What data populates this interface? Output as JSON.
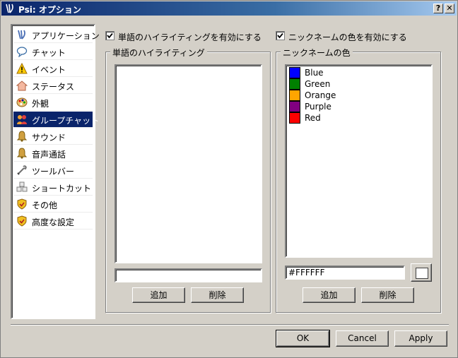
{
  "window": {
    "title": "Psi: オプション",
    "help_label": "?",
    "close_label": "✕"
  },
  "sidebar": {
    "items": [
      {
        "label": "アプリケーション",
        "icon": "psi-logo-icon"
      },
      {
        "label": "チャット",
        "icon": "chat-bubble-icon"
      },
      {
        "label": "イベント",
        "icon": "warning-icon"
      },
      {
        "label": "ステータス",
        "icon": "status-icon"
      },
      {
        "label": "外観",
        "icon": "palette-icon"
      },
      {
        "label": "グループチャット",
        "icon": "group-chat-icon",
        "selected": true
      },
      {
        "label": "サウンド",
        "icon": "bell-icon"
      },
      {
        "label": "音声通話",
        "icon": "bell-icon"
      },
      {
        "label": "ツールバー",
        "icon": "toolbar-icon"
      },
      {
        "label": "ショートカット",
        "icon": "shortcut-icon"
      },
      {
        "label": "その他",
        "icon": "shield-icon"
      },
      {
        "label": "高度な設定",
        "icon": "shield-icon"
      }
    ]
  },
  "highlight": {
    "checkbox_label": "単語のハイライティングを有効にする",
    "checked": true,
    "group_title": "単語のハイライティング",
    "input_value": "",
    "add_label": "追加",
    "remove_label": "削除"
  },
  "nick": {
    "checkbox_label": "ニックネームの色を有効にする",
    "checked": true,
    "group_title": "ニックネームの色",
    "colors": [
      {
        "name": "Blue",
        "hex": "#0000ff"
      },
      {
        "name": "Green",
        "hex": "#008000"
      },
      {
        "name": "Orange",
        "hex": "#ffa500"
      },
      {
        "name": "Purple",
        "hex": "#800080"
      },
      {
        "name": "Red",
        "hex": "#ff0000"
      }
    ],
    "color_value": "#FFFFFF",
    "swatch_color": "#ffffff",
    "add_label": "追加",
    "remove_label": "削除"
  },
  "footer": {
    "ok_label": "OK",
    "cancel_label": "Cancel",
    "apply_label": "Apply"
  }
}
